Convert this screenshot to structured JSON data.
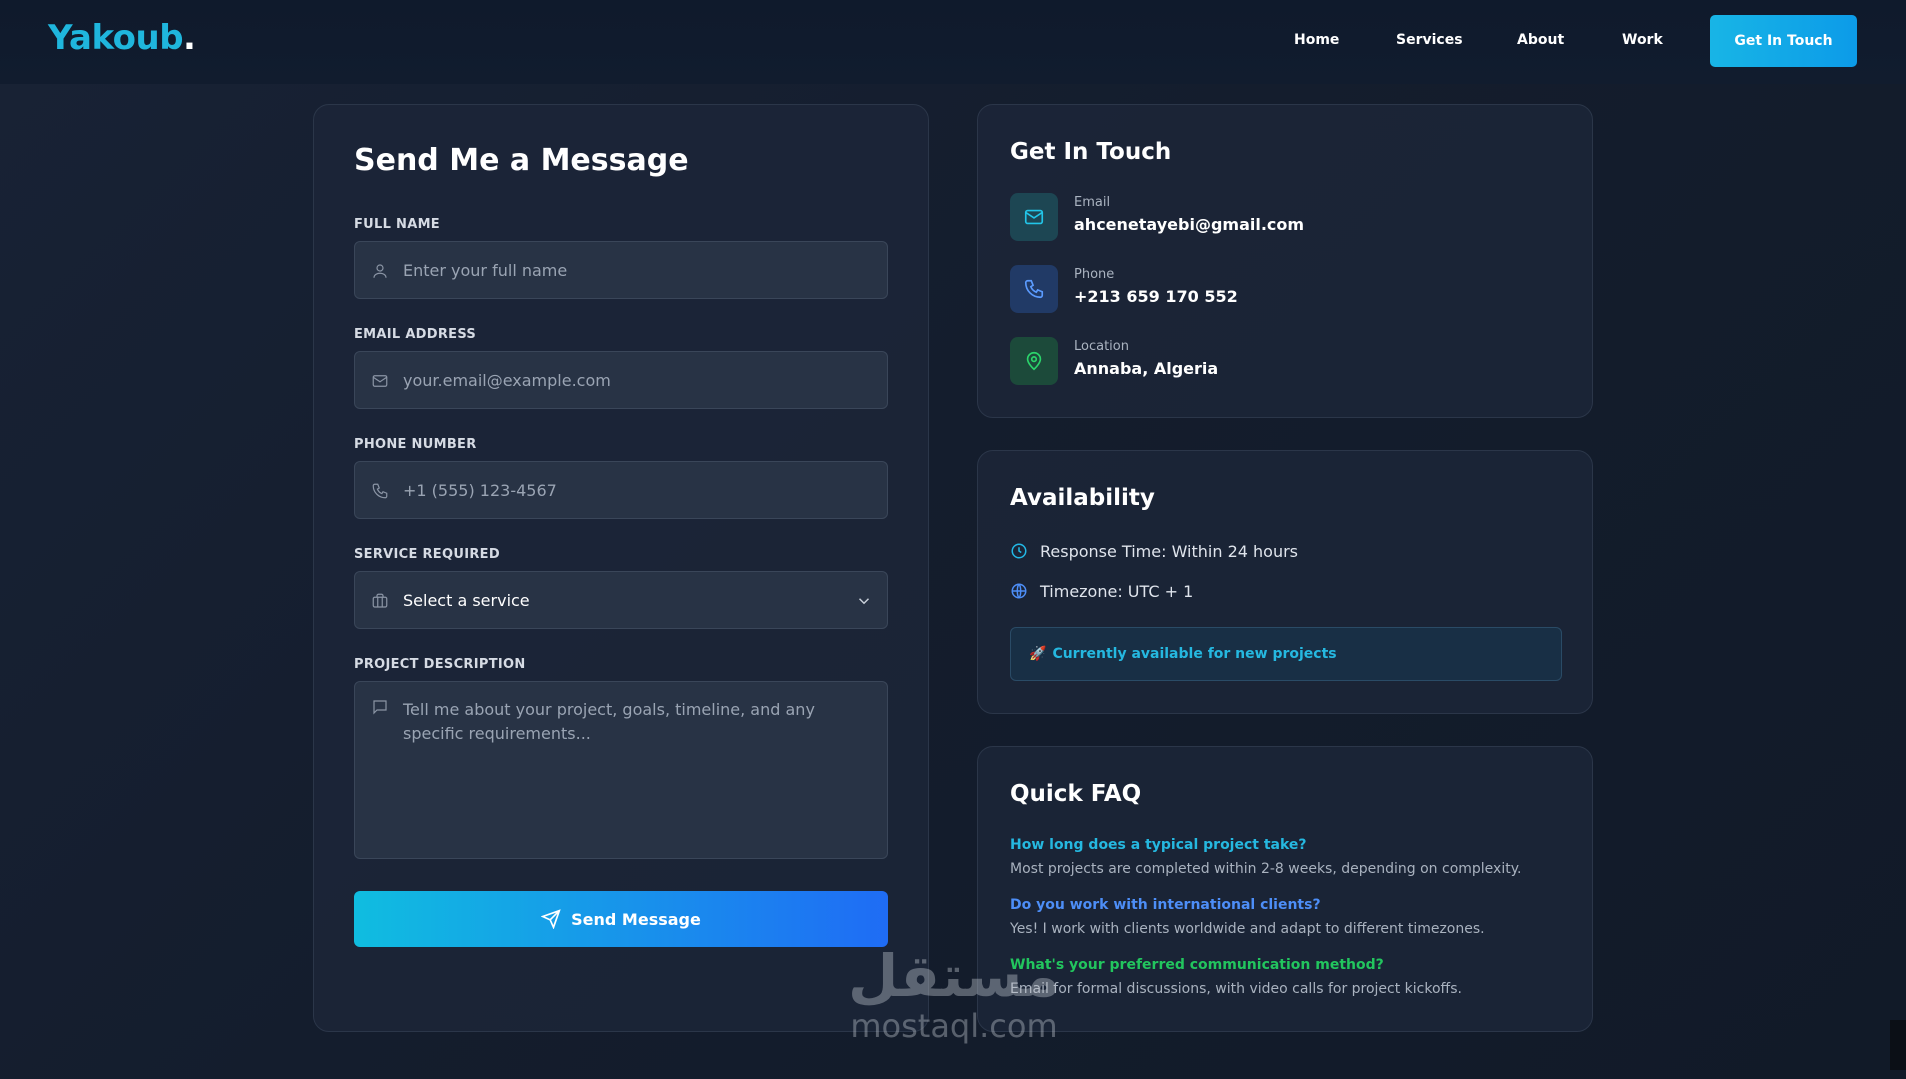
{
  "brand": {
    "name": "Yakoub",
    "dot": "."
  },
  "nav": {
    "items": [
      "Home",
      "Services",
      "About",
      "Work"
    ],
    "cta": "Get In Touch"
  },
  "form": {
    "title": "Send Me a Message",
    "fields": {
      "full_name": {
        "label": "FULL NAME",
        "placeholder": "Enter your full name"
      },
      "email": {
        "label": "EMAIL ADDRESS",
        "placeholder": "your.email@example.com"
      },
      "phone": {
        "label": "PHONE NUMBER",
        "placeholder": "+1 (555) 123-4567"
      },
      "service": {
        "label": "SERVICE REQUIRED",
        "selected": "Select a service"
      },
      "description": {
        "label": "PROJECT DESCRIPTION",
        "placeholder": "Tell me about your project, goals, timeline, and any specific requirements..."
      }
    },
    "submit_label": "Send Message"
  },
  "contact": {
    "title": "Get In Touch",
    "items": [
      {
        "label": "Email",
        "value": "ahcenetayebi@gmail.com",
        "icon": "mail-icon",
        "color": "#1fb6dd"
      },
      {
        "label": "Phone",
        "value": "+213 659 170 552",
        "icon": "phone-icon",
        "color": "#4d8ef7"
      },
      {
        "label": "Location",
        "value": "Annaba, Algeria",
        "icon": "map-pin-icon",
        "color": "#22c55e"
      }
    ]
  },
  "availability": {
    "title": "Availability",
    "response_time": "Response Time: Within 24 hours",
    "timezone": "Timezone: UTC + 1",
    "status_icon": "🚀",
    "status": "Currently available for new projects"
  },
  "faq": {
    "title": "Quick FAQ",
    "items": [
      {
        "q": "How long does a typical project take?",
        "a": "Most projects are completed within 2-8 weeks, depending on complexity.",
        "color": "#25b8e0"
      },
      {
        "q": "Do you work with international clients?",
        "a": "Yes! I work with clients worldwide and adapt to different timezones.",
        "color": "#4d8ef7"
      },
      {
        "q": "What's your preferred communication method?",
        "a": "Email for formal discussions, with video calls for project kickoffs.",
        "color": "#22c55e"
      }
    ]
  },
  "watermark": {
    "arabic": "مستقل",
    "latin": "mostaql.com"
  },
  "colors": {
    "accent": "#1fb6dd",
    "blue": "#1f6cf5",
    "green": "#22c55e",
    "card": "#1c2638"
  }
}
